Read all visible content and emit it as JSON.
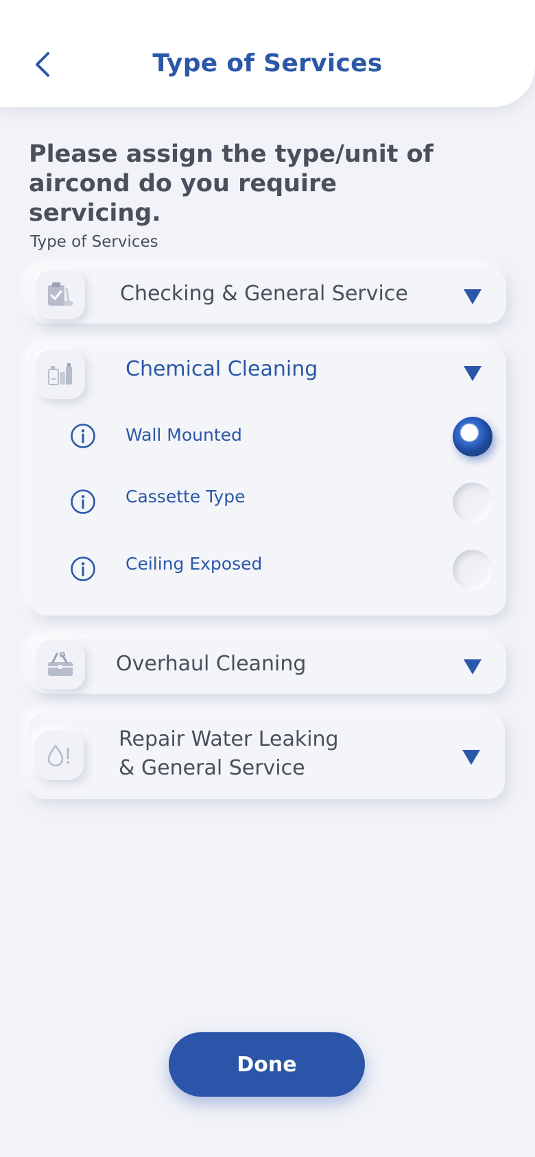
{
  "header": {
    "title": "Type of Services"
  },
  "instruction": "Please assign the type/unit of aircond do you require servicing.",
  "section_label": "Type of Services",
  "services": [
    {
      "title": "Checking & General Service",
      "icon": "clipboard-check-icon",
      "expanded": false
    },
    {
      "title": "Chemical Cleaning",
      "icon": "chemical-bottles-icon",
      "expanded": true,
      "units": [
        {
          "label": "Wall Mounted",
          "selected": true
        },
        {
          "label": "Cassette Type",
          "selected": false
        },
        {
          "label": "Ceiling Exposed",
          "selected": false
        }
      ]
    },
    {
      "title": "Overhaul Cleaning",
      "icon": "toolbox-icon",
      "expanded": false
    },
    {
      "title_line1": "Repair Water Leaking",
      "title_line2": "& General Service",
      "icon": "water-drop-alert-icon",
      "expanded": false
    }
  ],
  "done_button": {
    "label": "Done"
  },
  "colors": {
    "primary": "#2b57a8",
    "background": "#f2f3f8",
    "text": "#4a4f5c"
  }
}
